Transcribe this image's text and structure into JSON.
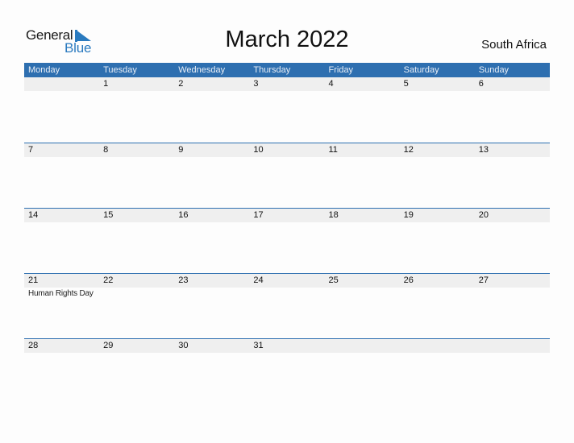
{
  "logo": {
    "general": "General",
    "blue": "Blue"
  },
  "title": "March 2022",
  "country": "South Africa",
  "colors": {
    "header_bg": "#2e6fb0",
    "brand_blue": "#2a7abf",
    "day_row_bg": "#efefef"
  },
  "weekdays": [
    "Monday",
    "Tuesday",
    "Wednesday",
    "Thursday",
    "Friday",
    "Saturday",
    "Sunday"
  ],
  "weeks": [
    {
      "days": [
        "",
        "1",
        "2",
        "3",
        "4",
        "5",
        "6"
      ],
      "events": [
        "",
        "",
        "",
        "",
        "",
        "",
        ""
      ]
    },
    {
      "days": [
        "7",
        "8",
        "9",
        "10",
        "11",
        "12",
        "13"
      ],
      "events": [
        "",
        "",
        "",
        "",
        "",
        "",
        ""
      ]
    },
    {
      "days": [
        "14",
        "15",
        "16",
        "17",
        "18",
        "19",
        "20"
      ],
      "events": [
        "",
        "",
        "",
        "",
        "",
        "",
        ""
      ]
    },
    {
      "days": [
        "21",
        "22",
        "23",
        "24",
        "25",
        "26",
        "27"
      ],
      "events": [
        "Human Rights Day",
        "",
        "",
        "",
        "",
        "",
        ""
      ]
    },
    {
      "days": [
        "28",
        "29",
        "30",
        "31",
        "",
        "",
        ""
      ],
      "events": [
        "",
        "",
        "",
        "",
        "",
        "",
        ""
      ]
    }
  ]
}
